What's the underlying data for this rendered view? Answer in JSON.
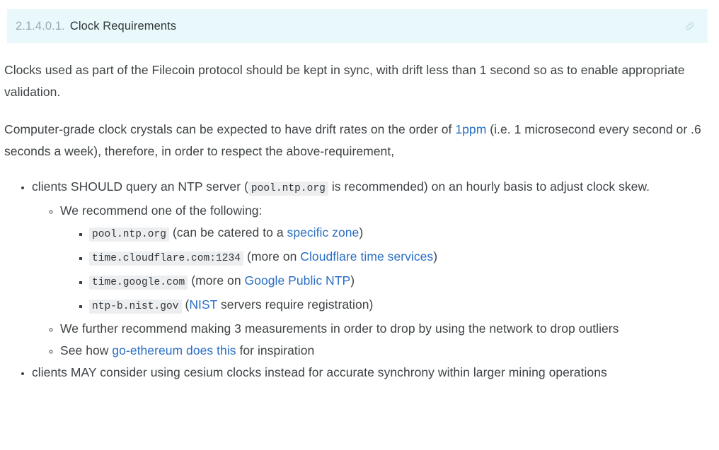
{
  "heading": {
    "number": "2.1.4.0.1.",
    "title": "Clock Requirements",
    "anchor_icon": "link-icon",
    "background_color": "#e8f8fb",
    "number_color": "#9aa8ae",
    "title_color": "#32373b"
  },
  "theme": {
    "link_color": "#2a6fc4",
    "text_color": "#3d4245",
    "code_background": "#eceef0"
  },
  "paragraphs": [
    {
      "segments": [
        {
          "type": "text",
          "value": "Clocks used as part of the Filecoin protocol should be kept in sync, with drift less than 1 second so as to enable appropriate validation."
        }
      ]
    },
    {
      "segments": [
        {
          "type": "text",
          "value": "Computer-grade clock crystals can be expected to have drift rates on the order of "
        },
        {
          "type": "link",
          "value": "1ppm"
        },
        {
          "type": "text",
          "value": " (i.e. 1 microsecond every second or .6 seconds a week), therefore, in order to respect the above-requirement,"
        }
      ]
    }
  ],
  "list": {
    "items": [
      {
        "segments": [
          {
            "type": "text",
            "value": "clients SHOULD query an NTP server ("
          },
          {
            "type": "code",
            "value": "pool.ntp.org"
          },
          {
            "type": "text",
            "value": " is recommended) on an hourly basis to adjust clock skew."
          }
        ],
        "children": [
          {
            "segments": [
              {
                "type": "text",
                "value": "We recommend one of the following:"
              }
            ],
            "children": [
              {
                "segments": [
                  {
                    "type": "code",
                    "value": "pool.ntp.org"
                  },
                  {
                    "type": "text",
                    "value": " (can be catered to a "
                  },
                  {
                    "type": "link",
                    "value": "specific zone"
                  },
                  {
                    "type": "text",
                    "value": ")"
                  }
                ]
              },
              {
                "segments": [
                  {
                    "type": "code",
                    "value": "time.cloudflare.com:1234"
                  },
                  {
                    "type": "text",
                    "value": " (more on "
                  },
                  {
                    "type": "link",
                    "value": "Cloudflare time services"
                  },
                  {
                    "type": "text",
                    "value": ")"
                  }
                ]
              },
              {
                "segments": [
                  {
                    "type": "code",
                    "value": "time.google.com"
                  },
                  {
                    "type": "text",
                    "value": " (more on "
                  },
                  {
                    "type": "link",
                    "value": "Google Public NTP"
                  },
                  {
                    "type": "text",
                    "value": ")"
                  }
                ]
              },
              {
                "segments": [
                  {
                    "type": "code",
                    "value": "ntp-b.nist.gov"
                  },
                  {
                    "type": "text",
                    "value": " ("
                  },
                  {
                    "type": "link",
                    "value": "NIST"
                  },
                  {
                    "type": "text",
                    "value": " servers require registration)"
                  }
                ]
              }
            ]
          },
          {
            "segments": [
              {
                "type": "text",
                "value": "We further recommend making 3 measurements in order to drop by using the network to drop outliers"
              }
            ]
          },
          {
            "segments": [
              {
                "type": "text",
                "value": "See how "
              },
              {
                "type": "link",
                "value": "go-ethereum does this"
              },
              {
                "type": "text",
                "value": " for inspiration"
              }
            ]
          }
        ]
      },
      {
        "segments": [
          {
            "type": "text",
            "value": "clients MAY consider using cesium clocks instead for accurate synchrony within larger mining operations"
          }
        ]
      }
    ]
  }
}
